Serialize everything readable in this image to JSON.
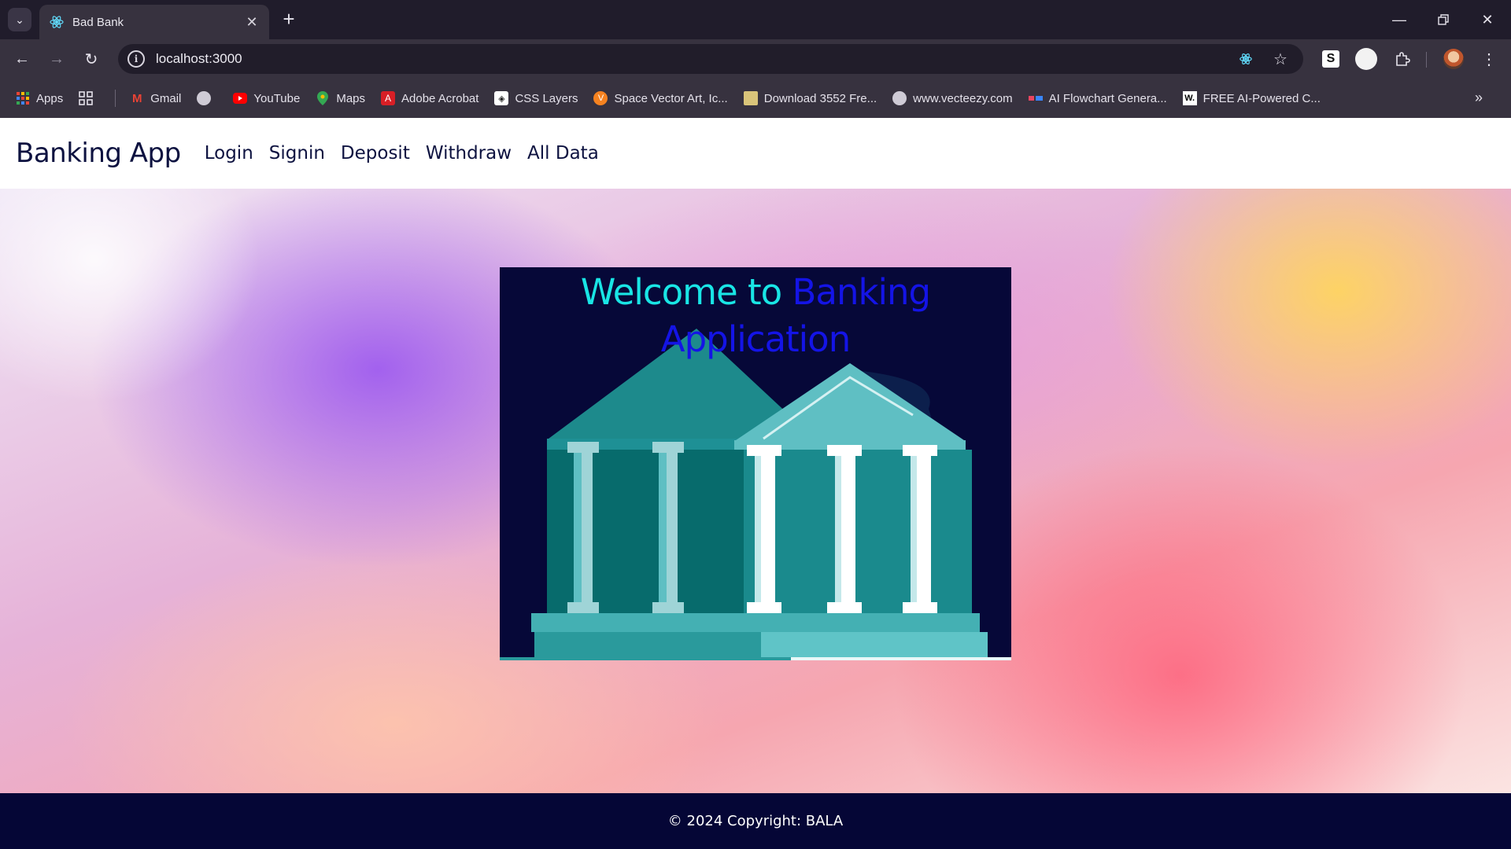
{
  "browser": {
    "tab_title": "Bad Bank",
    "url": "localhost:3000",
    "bookmarks": [
      {
        "label": "Apps",
        "icon": "apps-grid-icon"
      },
      {
        "label": "",
        "icon": "tab-groups-icon"
      },
      {
        "label": "Gmail",
        "icon": "gmail-icon"
      },
      {
        "label": "",
        "icon": "globe-icon"
      },
      {
        "label": "YouTube",
        "icon": "youtube-icon"
      },
      {
        "label": "Maps",
        "icon": "maps-icon"
      },
      {
        "label": "Adobe Acrobat",
        "icon": "acrobat-icon"
      },
      {
        "label": "CSS Layers",
        "icon": "css-layers-icon"
      },
      {
        "label": "Space Vector Art, Ic...",
        "icon": "vecteezy-icon"
      },
      {
        "label": "Download 3552 Fre...",
        "icon": "image-icon"
      },
      {
        "label": "www.vecteezy.com",
        "icon": "globe-icon"
      },
      {
        "label": "AI Flowchart Genera...",
        "icon": "flowchart-icon"
      },
      {
        "label": "FREE AI-Powered C...",
        "icon": "w-icon"
      }
    ]
  },
  "app": {
    "brand": "Banking App",
    "nav": [
      "Login",
      "Signin",
      "Deposit",
      "Withdraw",
      "All Data"
    ],
    "hero": {
      "title_part1": "Welcome to",
      "title_part2": "Banking Application"
    },
    "footer": "© 2024 Copyright: BALA"
  },
  "colors": {
    "nav_text": "#0d1240",
    "card_bg": "#060838",
    "title_cyan": "#19e5e5",
    "title_blue": "#1414e6",
    "footer_bg": "#050636"
  }
}
